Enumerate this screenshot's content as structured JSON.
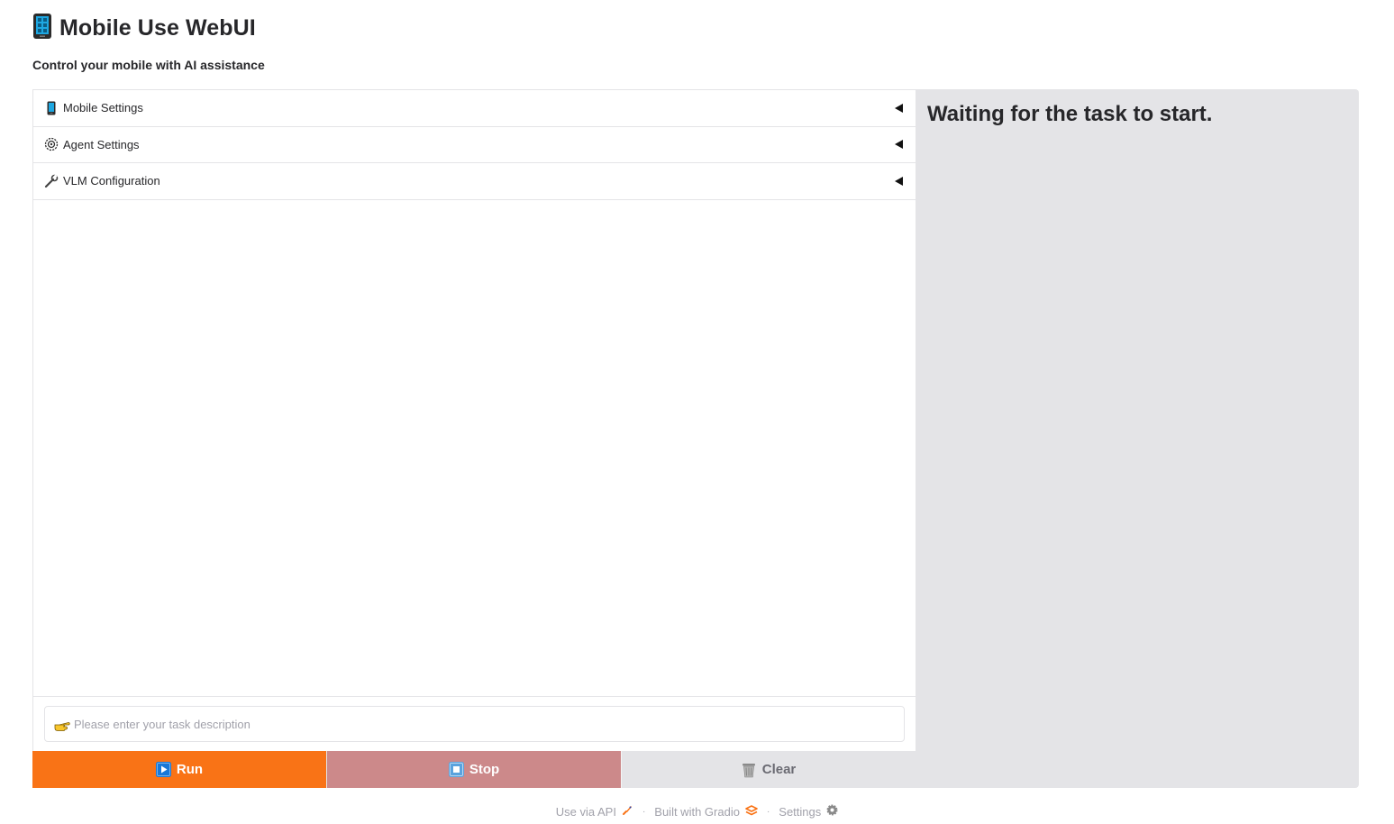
{
  "app": {
    "title": "Mobile Use WebUI",
    "subtitle": "Control your mobile with AI assistance",
    "title_icon": "mobile-phone-icon"
  },
  "accordions": [
    {
      "label": "Mobile Settings",
      "icon": "mobile-phone-icon"
    },
    {
      "label": "Agent Settings",
      "icon": "gear-icon"
    },
    {
      "label": "VLM Configuration",
      "icon": "wrench-icon"
    }
  ],
  "task": {
    "placeholder": "Please enter your task description",
    "value": "",
    "icon": "pointing-hand-icon"
  },
  "buttons": {
    "run": "Run",
    "stop": "Stop",
    "clear": "Clear"
  },
  "status": {
    "message": "Waiting for the task to start."
  },
  "footer": {
    "api": "Use via API",
    "built": "Built with Gradio",
    "settings": "Settings"
  },
  "colors": {
    "accent": "#f97316",
    "stop": "#cc898a",
    "clear": "#e4e4e7",
    "panel": "#e4e4e7"
  }
}
